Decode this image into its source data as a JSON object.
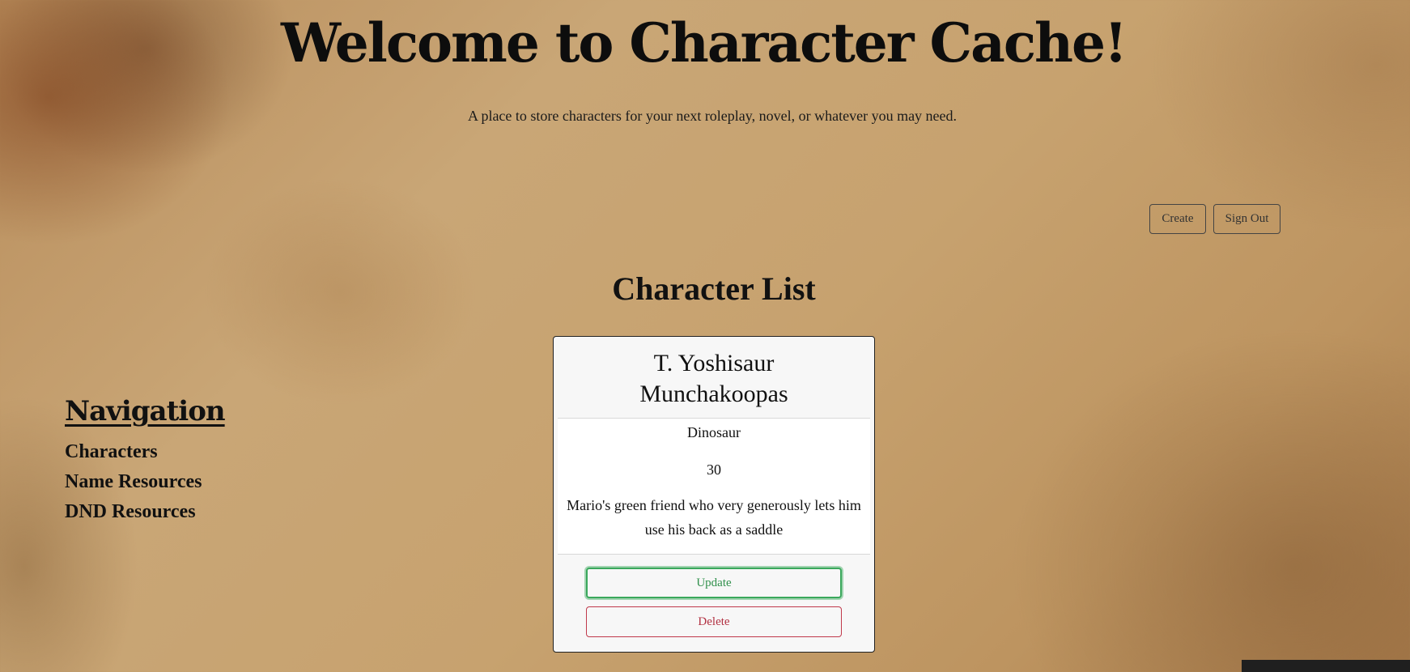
{
  "header": {
    "title": "Welcome to Character Cache!",
    "subtitle": "A place to store characters for your next roleplay, novel, or whatever you may need."
  },
  "actions": {
    "create_label": "Create",
    "signout_label": "Sign Out"
  },
  "main": {
    "list_title": "Character List"
  },
  "navigation": {
    "heading": "Navigation",
    "items": [
      {
        "label": "Characters"
      },
      {
        "label": "Name Resources"
      },
      {
        "label": "DND Resources"
      }
    ]
  },
  "characters": [
    {
      "name_line1": "T. Yoshisaur",
      "name_line2": "Munchakoopas",
      "species": "Dinosaur",
      "age": "30",
      "description": "Mario's green friend who very generously lets him use his back as a saddle",
      "update_label": "Update",
      "delete_label": "Delete"
    }
  ],
  "colors": {
    "update_accent": "#3aa85c",
    "delete_accent": "#c0394b",
    "parchment": "#c7a26f"
  }
}
